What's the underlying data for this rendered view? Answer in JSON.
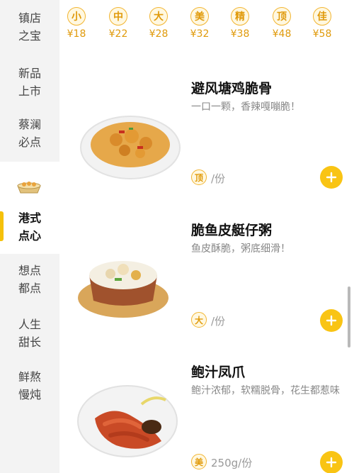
{
  "sidebar": {
    "items": [
      {
        "label": "镇店之宝"
      },
      {
        "label": "新品上市"
      },
      {
        "label": "蔡澜必点"
      },
      {
        "label": "港式点心"
      },
      {
        "label": "想点都点"
      },
      {
        "label": "人生甜长"
      },
      {
        "label": "鲜熬慢炖"
      }
    ]
  },
  "price_scale": [
    {
      "size": "小",
      "price": "¥18"
    },
    {
      "size": "中",
      "price": "¥22"
    },
    {
      "size": "大",
      "price": "¥28"
    },
    {
      "size": "美",
      "price": "¥32"
    },
    {
      "size": "精",
      "price": "¥38"
    },
    {
      "size": "顶",
      "price": "¥48"
    },
    {
      "size": "佳",
      "price": "¥58"
    }
  ],
  "dishes": [
    {
      "name": "避风塘鸡脆骨",
      "desc": "一口一颗，香辣嘎嘣脆！",
      "size": "顶",
      "unit": "/份"
    },
    {
      "name": "脆鱼皮艇仔粥",
      "desc": "鱼皮酥脆，粥底细滑！",
      "size": "大",
      "unit": "/份"
    },
    {
      "name": "鲍汁凤爪",
      "desc": "鲍汁浓郁，软糯脱骨，花生都惹味",
      "size": "美",
      "unit": "250g/份"
    }
  ],
  "colors": {
    "accent": "#f9c414",
    "badge": "#e09a0b",
    "sidebar_bg": "#f3f3f3"
  },
  "icons": {
    "add": "plus-icon"
  }
}
